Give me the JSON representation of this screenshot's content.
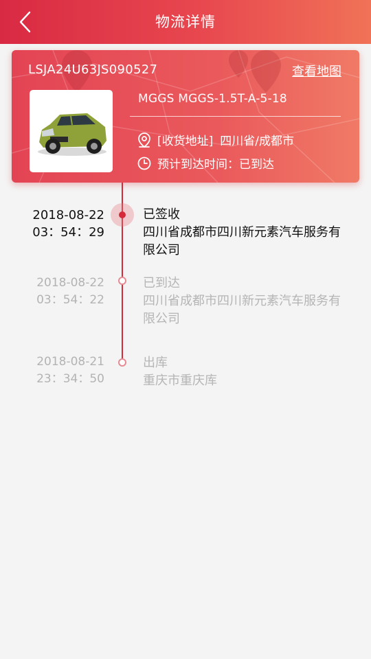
{
  "header": {
    "title": "物流详情"
  },
  "card": {
    "vin": "LSJA24U63JS090527",
    "map_link": "查看地图",
    "model": "MGGS MGGS-1.5T-A-5-18",
    "address_label": "[收货地址]",
    "address_value": "四川省/成都市",
    "eta_label": "预计到达时间：",
    "eta_value": "已到达"
  },
  "timeline": [
    {
      "date": "2018-08-22",
      "time": "03：54：29",
      "status": "已签收",
      "location": "四川省成都市四川新元素汽车服务有限公司",
      "active": true
    },
    {
      "date": "2018-08-22",
      "time": "03：54：22",
      "status": "已到达",
      "location": "四川省成都市四川新元素汽车服务有限公司",
      "active": false
    },
    {
      "date": "2018-08-21",
      "time": "23：34：50",
      "status": "出库",
      "location": "重庆市重庆库",
      "active": false
    }
  ],
  "colors": {
    "header_start": "#d92a43",
    "header_end": "#f07257",
    "timeline": "#d42a3a"
  }
}
